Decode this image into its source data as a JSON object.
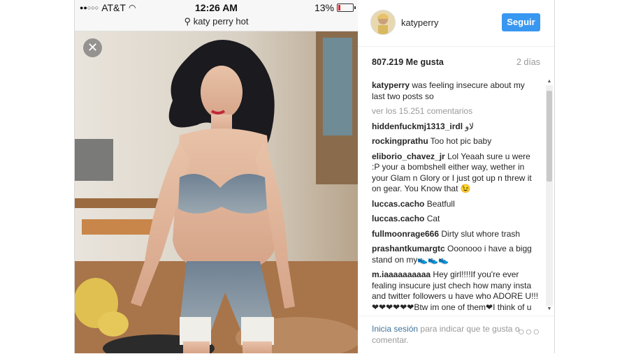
{
  "status_bar": {
    "carrier": "AT&T",
    "time": "12:26 AM",
    "battery": "13%",
    "battery_level": 0.13
  },
  "search": {
    "query": "katy perry hot"
  },
  "post": {
    "username": "katyperry",
    "follow_label": "Seguir",
    "likes": "807.219 Me gusta",
    "age": "2 días",
    "caption_user": "katyperry",
    "caption_text": "was feeling insecure about my last two posts so",
    "view_all": "ver los 15.251 comentarios",
    "comments": [
      {
        "user": "hiddenfuckmj1313_irdl",
        "text": "لاو"
      },
      {
        "user": "rockingprathu",
        "text": "Too hot pic baby"
      },
      {
        "user": "eliborio_chavez_jr",
        "text": "Lol Yeaah sure u were :P your a bombshell either way, wether in your Glam n Glory or I just got up n threw it on gear. You Know that 😉"
      },
      {
        "user": "luccas.cacho",
        "text": "Beatfull"
      },
      {
        "user": "luccas.cacho",
        "text": "Cat"
      },
      {
        "user": "fullmoonrage666",
        "text": "Dirty slut whore trash"
      },
      {
        "user": "prashantkumargtc",
        "text": "Ooonooo i have a bigg stand on my👟👟👟"
      },
      {
        "user": "m.iaaaaaaaaaa",
        "text": "Hey girl!!!!If you're ever fealing insucure just chech how many insta and twitter followers u have who ADORE U!!!❤❤❤❤❤❤Btw im one of them❤I think of u when i feel insucure😊"
      }
    ],
    "login_link": "Inicia sesión",
    "login_rest": "para indicar que te gusta o comentar."
  },
  "colors": {
    "follow_button": "#3897f0",
    "link": "#3f729b"
  },
  "icons": {
    "close": "close-icon",
    "search": "search-icon",
    "more": "more-icon"
  }
}
